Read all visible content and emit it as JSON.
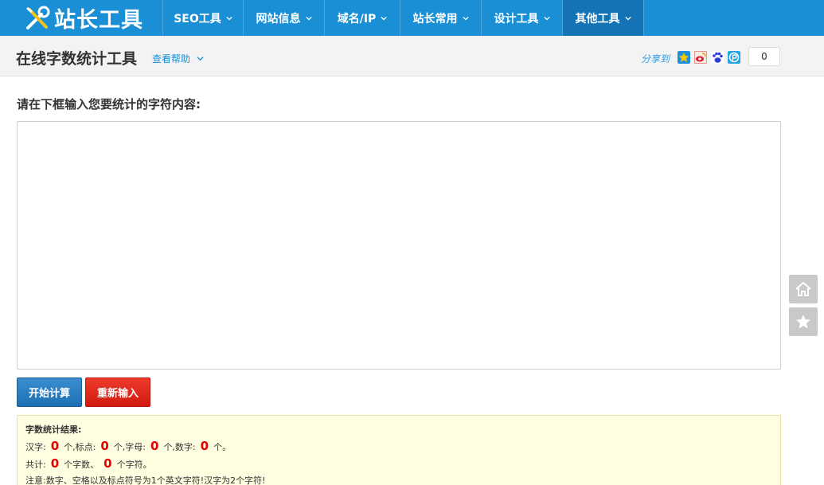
{
  "logo": {
    "text": "站长工具"
  },
  "nav": [
    {
      "label": "SEO工具"
    },
    {
      "label": "网站信息"
    },
    {
      "label": "域名/IP"
    },
    {
      "label": "站长常用"
    },
    {
      "label": "设计工具"
    },
    {
      "label": "其他工具",
      "active": true
    }
  ],
  "subheader": {
    "title": "在线字数统计工具",
    "help": "查看帮助",
    "share_label": "分享到",
    "share_count": "0"
  },
  "main": {
    "prompt": "请在下框输入您要统计的字符内容:",
    "textarea_value": "",
    "start_button": "开始计算",
    "reset_button": "重新输入"
  },
  "result": {
    "title": "字数统计结果:",
    "line1": {
      "hanzi_label": "汉字:",
      "hanzi": "0",
      "unit1": "个,标点:",
      "punct": "0",
      "unit2": "个,字母:",
      "letters": "0",
      "unit3": "个,数字:",
      "digits": "0",
      "unit4": "个。"
    },
    "line2": {
      "total_label": "共计:",
      "words": "0",
      "unit1": "个字数、",
      "chars": "0",
      "unit2": "个字符。"
    },
    "note": "注意:数字、空格以及标点符号为1个英文字符!汉字为2个字符!"
  },
  "colors": {
    "nav_bg": "#1a8fd6",
    "nav_active": "#1473b4",
    "accent_red": "#e60000"
  }
}
